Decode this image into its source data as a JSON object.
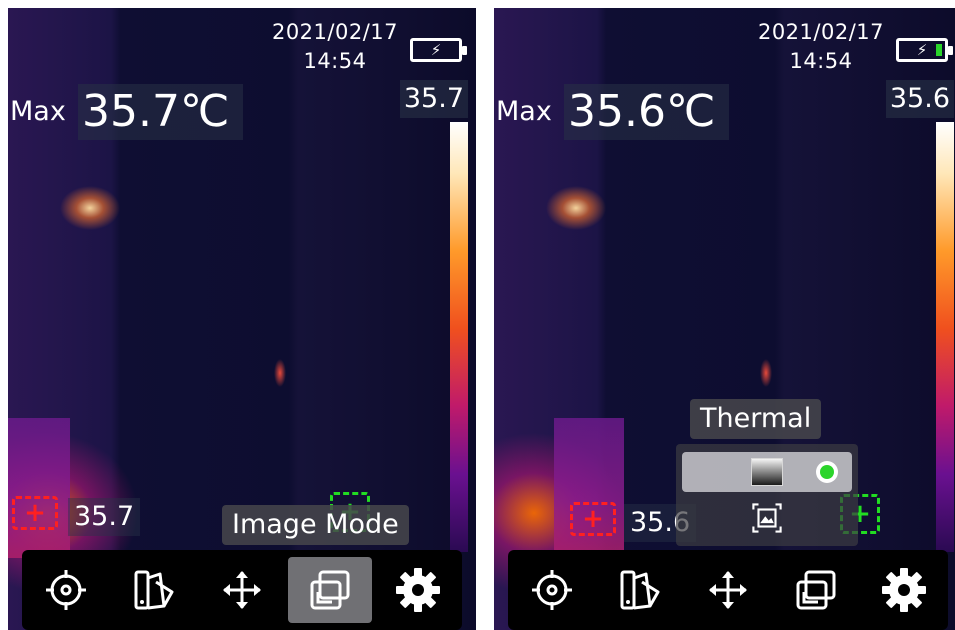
{
  "screens": [
    {
      "date": "2021/02/17",
      "time": "14:54",
      "max_label": "Max",
      "max_value": "35.7℃",
      "scale_top": "35.7",
      "spot_value": "35.7",
      "battery": "charging",
      "active_tool": "image-mode",
      "tooltip": "Image Mode"
    },
    {
      "date": "2021/02/17",
      "time": "14:54",
      "max_label": "Max",
      "max_value": "35.6℃",
      "scale_top": "35.6",
      "spot_value": "35.6",
      "battery": "charging-full",
      "active_tool": "none",
      "tooltip": "Thermal",
      "image_mode_options": [
        "thermal",
        "image-fusion"
      ],
      "selected_option": "thermal"
    }
  ],
  "toolbar": [
    "target-icon",
    "palette-icon",
    "move-icon",
    "image-mode-icon",
    "gear-icon"
  ],
  "colors": {
    "spot_marker": "#ff2020",
    "center_marker": "#22dd22",
    "battery_level": "#2bd42b",
    "radio_selected": "#2bd42b"
  }
}
